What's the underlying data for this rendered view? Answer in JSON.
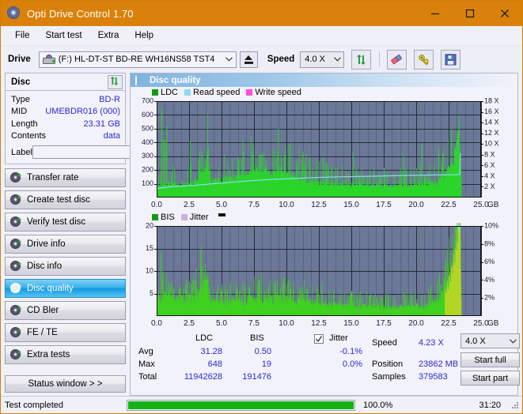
{
  "window": {
    "title": "Opti Drive Control 1.70",
    "icon": "disc-icon",
    "minimize": "–",
    "maximize": "□",
    "close": "✕"
  },
  "menu": {
    "items": [
      "File",
      "Start test",
      "Extra",
      "Help"
    ]
  },
  "toolbar": {
    "drive_label": "Drive",
    "drive_value": "(F:)  HL-DT-ST BD-RE  WH16NS58 TST4",
    "eject_icon": "eject-icon",
    "speed_label": "Speed",
    "speed_value": "4.0 X",
    "refresh_icon": "refresh-icon",
    "eraser_icon": "eraser-icon",
    "key_icon": "key-icon",
    "save_icon": "save-icon"
  },
  "disc_panel": {
    "title": "Disc",
    "refresh_icon": "refresh-icon",
    "rows": [
      {
        "key": "Type",
        "value": "BD-R"
      },
      {
        "key": "MID",
        "value": "UMEBDR016 (000)"
      },
      {
        "key": "Length",
        "value": "23.31 GB"
      },
      {
        "key": "Contents",
        "value": "data"
      }
    ],
    "label_key": "Label",
    "label_value": "",
    "label_placeholder": "",
    "disc_icon": "cd-icon"
  },
  "sidebar": {
    "items": [
      {
        "label": "Transfer rate",
        "active": false
      },
      {
        "label": "Create test disc",
        "active": false
      },
      {
        "label": "Verify test disc",
        "active": false
      },
      {
        "label": "Drive info",
        "active": false
      },
      {
        "label": "Disc info",
        "active": false
      },
      {
        "label": "Disc quality",
        "active": true
      },
      {
        "label": "CD Bler",
        "active": false
      },
      {
        "label": "FE / TE",
        "active": false
      },
      {
        "label": "Extra tests",
        "active": false
      }
    ],
    "status_window_button": "Status window > >"
  },
  "main": {
    "header_title": "Disc quality",
    "header_icon": "disc-icon"
  },
  "stats": {
    "col_ldc": "LDC",
    "col_bis": "BIS",
    "row_avg": "Avg",
    "row_max": "Max",
    "row_total": "Total",
    "ldc_avg": "31.28",
    "ldc_max": "648",
    "ldc_total": "11942628",
    "bis_avg": "0.50",
    "bis_max": "19",
    "bis_total": "191476",
    "jitter_label": "Jitter",
    "jitter_checked": true,
    "jitter_avg": "-0.1%",
    "jitter_max": "0.0%",
    "speed_label": "Speed",
    "speed_value": "4.23 X",
    "position_label": "Position",
    "position_value": "23862 MB",
    "samples_label": "Samples",
    "samples_value": "379583",
    "speed_select": "4.0 X",
    "start_full": "Start full",
    "start_part": "Start part"
  },
  "statusbar": {
    "message": "Test completed",
    "percent_label": "100.0%",
    "percent_value": 100,
    "elapsed": "31:20"
  },
  "colors": {
    "title_bar": "#d9810a",
    "plot_bg": "#6b7897",
    "ldc_green": "#2bd52b",
    "bis_green": "#3fd21f",
    "read_speed": "#8fd8f5",
    "write_speed": "#ff4fd8",
    "jitter": "#c9b3d9",
    "value_blue": "#2929d6",
    "progress_green": "#12b312",
    "active_nav": "#0d9ae0"
  },
  "chart_data": [
    {
      "type": "area",
      "name": "ldc-chart",
      "title": "",
      "xlabel": "GB",
      "ylabel": "",
      "xlim": [
        0,
        25
      ],
      "ylim": [
        0,
        700
      ],
      "y2lim": [
        0,
        18
      ],
      "xticks": [
        "0.0",
        "2.5",
        "5.0",
        "7.5",
        "10.0",
        "12.5",
        "15.0",
        "17.5",
        "20.0",
        "22.5",
        "25.0"
      ],
      "xtick_values": [
        0,
        2.5,
        5,
        7.5,
        10,
        12.5,
        15,
        17.5,
        20,
        22.5,
        25
      ],
      "yticks": [
        "100",
        "200",
        "300",
        "400",
        "500",
        "600",
        "700"
      ],
      "ytick_values": [
        100,
        200,
        300,
        400,
        500,
        600,
        700
      ],
      "y2ticks": [
        "2 X",
        "4 X",
        "6 X",
        "8 X",
        "10 X",
        "12 X",
        "14 X",
        "16 X",
        "18 X"
      ],
      "y2tick_values": [
        2,
        4,
        6,
        8,
        10,
        12,
        14,
        16,
        18
      ],
      "unit_suffix": "GB",
      "grid": true,
      "legend": [
        {
          "label": "LDC",
          "color": "#119b11"
        },
        {
          "label": "Read speed",
          "color": "#8fd8f5"
        },
        {
          "label": "Write speed",
          "color": "#ff4fd8"
        }
      ],
      "series": [
        {
          "name": "LDC",
          "color": "#2bd52b",
          "kind": "spikes",
          "baseline": [
            {
              "x": 0.0,
              "y": 75
            },
            {
              "x": 0.3,
              "y": 85
            },
            {
              "x": 0.8,
              "y": 95
            },
            {
              "x": 1.5,
              "y": 90
            },
            {
              "x": 2.2,
              "y": 92
            },
            {
              "x": 3.0,
              "y": 110
            },
            {
              "x": 3.6,
              "y": 180
            },
            {
              "x": 3.9,
              "y": 300
            },
            {
              "x": 4.1,
              "y": 120
            },
            {
              "x": 5.0,
              "y": 120
            },
            {
              "x": 6.0,
              "y": 140
            },
            {
              "x": 7.0,
              "y": 165
            },
            {
              "x": 7.6,
              "y": 185
            },
            {
              "x": 8.5,
              "y": 170
            },
            {
              "x": 9.5,
              "y": 165
            },
            {
              "x": 10.5,
              "y": 150
            },
            {
              "x": 11.5,
              "y": 120
            },
            {
              "x": 12.5,
              "y": 100
            },
            {
              "x": 13.5,
              "y": 92
            },
            {
              "x": 15.0,
              "y": 88
            },
            {
              "x": 16.5,
              "y": 82
            },
            {
              "x": 18.0,
              "y": 80
            },
            {
              "x": 19.5,
              "y": 82
            },
            {
              "x": 21.0,
              "y": 95
            },
            {
              "x": 22.0,
              "y": 130
            },
            {
              "x": 22.6,
              "y": 200
            },
            {
              "x": 23.0,
              "y": 330
            },
            {
              "x": 23.3,
              "y": 520
            },
            {
              "x": 23.45,
              "y": 90
            }
          ],
          "spikes": [
            {
              "x": 0.35,
              "y": 645
            },
            {
              "x": 0.5,
              "y": 420
            },
            {
              "x": 0.62,
              "y": 410
            },
            {
              "x": 0.75,
              "y": 520
            },
            {
              "x": 1.1,
              "y": 180
            },
            {
              "x": 1.35,
              "y": 160
            },
            {
              "x": 2.55,
              "y": 410
            },
            {
              "x": 2.6,
              "y": 250
            },
            {
              "x": 3.85,
              "y": 305
            },
            {
              "x": 5.6,
              "y": 200
            },
            {
              "x": 6.3,
              "y": 210
            },
            {
              "x": 7.4,
              "y": 250
            },
            {
              "x": 8.1,
              "y": 320
            },
            {
              "x": 8.35,
              "y": 230
            },
            {
              "x": 9.35,
              "y": 500
            },
            {
              "x": 9.6,
              "y": 230
            },
            {
              "x": 11.2,
              "y": 270
            },
            {
              "x": 11.45,
              "y": 200
            },
            {
              "x": 12.8,
              "y": 290
            },
            {
              "x": 13.1,
              "y": 180
            },
            {
              "x": 15.1,
              "y": 330
            },
            {
              "x": 15.35,
              "y": 175
            },
            {
              "x": 16.2,
              "y": 160
            },
            {
              "x": 17.3,
              "y": 150
            },
            {
              "x": 19.0,
              "y": 300
            },
            {
              "x": 19.2,
              "y": 180
            },
            {
              "x": 20.4,
              "y": 390
            },
            {
              "x": 20.6,
              "y": 165
            },
            {
              "x": 21.7,
              "y": 365
            },
            {
              "x": 21.95,
              "y": 250
            },
            {
              "x": 22.3,
              "y": 195
            }
          ]
        },
        {
          "name": "Read speed",
          "color": "#8fd8f5",
          "kind": "line",
          "axis": "right",
          "points": [
            {
              "x": 0.0,
              "y": 1.7
            },
            {
              "x": 1.0,
              "y": 2.0
            },
            {
              "x": 2.0,
              "y": 2.15
            },
            {
              "x": 3.0,
              "y": 2.3
            },
            {
              "x": 4.0,
              "y": 2.5
            },
            {
              "x": 5.0,
              "y": 2.7
            },
            {
              "x": 6.0,
              "y": 2.9
            },
            {
              "x": 7.0,
              "y": 3.1
            },
            {
              "x": 8.0,
              "y": 3.25
            },
            {
              "x": 9.0,
              "y": 3.4
            },
            {
              "x": 10.0,
              "y": 3.5
            },
            {
              "x": 11.0,
              "y": 3.6
            },
            {
              "x": 12.0,
              "y": 3.7
            },
            {
              "x": 13.0,
              "y": 3.8
            },
            {
              "x": 14.0,
              "y": 3.85
            },
            {
              "x": 15.0,
              "y": 3.9
            },
            {
              "x": 16.0,
              "y": 3.95
            },
            {
              "x": 17.0,
              "y": 4.0
            },
            {
              "x": 18.0,
              "y": 4.05
            },
            {
              "x": 19.0,
              "y": 4.1
            },
            {
              "x": 20.0,
              "y": 4.15
            },
            {
              "x": 21.0,
              "y": 4.2
            },
            {
              "x": 22.0,
              "y": 4.22
            },
            {
              "x": 23.0,
              "y": 4.25
            },
            {
              "x": 23.4,
              "y": 4.3
            },
            {
              "x": 23.45,
              "y": 18.0
            }
          ]
        }
      ]
    },
    {
      "type": "area",
      "name": "bis-chart",
      "title": "",
      "xlabel": "GB",
      "ylabel": "",
      "xlim": [
        0,
        25
      ],
      "ylim": [
        0,
        20
      ],
      "y2lim": [
        0,
        10
      ],
      "xticks": [
        "0.0",
        "2.5",
        "5.0",
        "7.5",
        "10.0",
        "12.5",
        "15.0",
        "17.5",
        "20.0",
        "22.5",
        "25.0"
      ],
      "xtick_values": [
        0,
        2.5,
        5,
        7.5,
        10,
        12.5,
        15,
        17.5,
        20,
        22.5,
        25
      ],
      "yticks": [
        "5",
        "10",
        "15",
        "20"
      ],
      "ytick_values": [
        5,
        10,
        15,
        20
      ],
      "y2ticks": [
        "2%",
        "4%",
        "6%",
        "8%",
        "10%"
      ],
      "y2tick_values": [
        2,
        4,
        6,
        8,
        10
      ],
      "unit_suffix": "GB",
      "grid": true,
      "legend": [
        {
          "label": "BIS",
          "color": "#119b11"
        },
        {
          "label": "Jitter",
          "color": "#c9b3d9"
        }
      ],
      "series": [
        {
          "name": "BIS",
          "color": "#3fd21f",
          "kind": "spikes",
          "baseline": [
            {
              "x": 0.0,
              "y": 4.0
            },
            {
              "x": 0.4,
              "y": 4.5
            },
            {
              "x": 1.0,
              "y": 3.6
            },
            {
              "x": 2.0,
              "y": 3.4
            },
            {
              "x": 3.0,
              "y": 3.8
            },
            {
              "x": 3.6,
              "y": 7.0
            },
            {
              "x": 3.85,
              "y": 10.1
            },
            {
              "x": 4.0,
              "y": 3.0
            },
            {
              "x": 5.0,
              "y": 2.8
            },
            {
              "x": 6.0,
              "y": 3.0
            },
            {
              "x": 7.0,
              "y": 3.4
            },
            {
              "x": 8.0,
              "y": 3.6
            },
            {
              "x": 9.0,
              "y": 3.5
            },
            {
              "x": 10.0,
              "y": 3.4
            },
            {
              "x": 11.0,
              "y": 3.2
            },
            {
              "x": 12.0,
              "y": 2.8
            },
            {
              "x": 13.0,
              "y": 2.4
            },
            {
              "x": 14.5,
              "y": 2.2
            },
            {
              "x": 16.0,
              "y": 2.0
            },
            {
              "x": 17.5,
              "y": 1.9
            },
            {
              "x": 19.0,
              "y": 2.0
            },
            {
              "x": 20.5,
              "y": 2.2
            },
            {
              "x": 21.5,
              "y": 3.0
            },
            {
              "x": 22.3,
              "y": 5.5
            },
            {
              "x": 22.8,
              "y": 9.0
            },
            {
              "x": 23.1,
              "y": 15.0
            },
            {
              "x": 23.35,
              "y": 19.2
            },
            {
              "x": 23.45,
              "y": 2.0
            }
          ],
          "spikes": [
            {
              "x": 0.3,
              "y": 14.0
            },
            {
              "x": 0.45,
              "y": 8.5
            },
            {
              "x": 0.7,
              "y": 9.5
            },
            {
              "x": 0.9,
              "y": 7.5
            },
            {
              "x": 1.3,
              "y": 6.0
            },
            {
              "x": 2.3,
              "y": 8.0
            },
            {
              "x": 3.5,
              "y": 11.0
            },
            {
              "x": 4.6,
              "y": 5.5
            },
            {
              "x": 5.4,
              "y": 5.8
            },
            {
              "x": 6.2,
              "y": 6.5
            },
            {
              "x": 7.1,
              "y": 6.0
            },
            {
              "x": 7.9,
              "y": 8.0
            },
            {
              "x": 8.6,
              "y": 6.8
            },
            {
              "x": 9.1,
              "y": 7.8
            },
            {
              "x": 9.5,
              "y": 6.2
            },
            {
              "x": 10.3,
              "y": 6.0
            },
            {
              "x": 11.0,
              "y": 5.6
            },
            {
              "x": 11.6,
              "y": 6.0
            },
            {
              "x": 12.7,
              "y": 7.5
            },
            {
              "x": 13.6,
              "y": 5.0
            },
            {
              "x": 15.0,
              "y": 5.5
            },
            {
              "x": 16.4,
              "y": 4.6
            },
            {
              "x": 17.6,
              "y": 4.2
            },
            {
              "x": 19.0,
              "y": 5.2
            },
            {
              "x": 20.4,
              "y": 4.6
            },
            {
              "x": 21.1,
              "y": 6.8
            },
            {
              "x": 21.9,
              "y": 7.0
            },
            {
              "x": 22.1,
              "y": 8.5
            }
          ]
        },
        {
          "name": "Jitter",
          "color": "#c9b3d9",
          "kind": "line",
          "axis": "right",
          "points": []
        }
      ]
    }
  ]
}
